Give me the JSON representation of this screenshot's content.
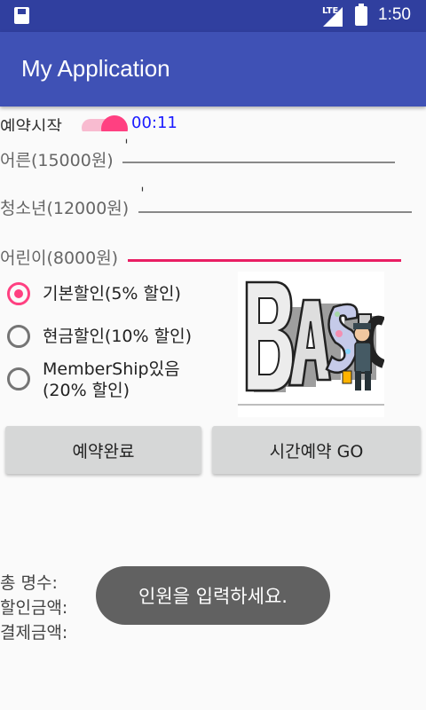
{
  "status_bar": {
    "network": "LTE",
    "time": "1:50",
    "icons": [
      "sd-card-icon",
      "signal-icon",
      "battery-icon"
    ]
  },
  "app_bar": {
    "title": "My Application"
  },
  "reservation": {
    "label": "예약시작",
    "switch_on": true,
    "time": "00:11"
  },
  "fields": {
    "adult": {
      "label": "어른(15000원)",
      "value": ""
    },
    "teen": {
      "label": "청소년(12000원)",
      "value": ""
    },
    "child": {
      "label": "어린이(8000원)",
      "value": ""
    }
  },
  "discounts": {
    "selected": "basic",
    "options": [
      {
        "id": "basic",
        "label": "기본할인(5% 할인)"
      },
      {
        "id": "cash",
        "label": "현금할인(10% 할인)"
      },
      {
        "id": "member",
        "label": "MemberShip있음\n(20% 할인)"
      }
    ]
  },
  "image": {
    "text": "BASIC"
  },
  "buttons": {
    "complete": "예약완료",
    "time_reserve": "시간예약 GO"
  },
  "summary": {
    "total_count": "총 명수:",
    "discount_amount": "할인금액:",
    "payment_amount": "결제금액:"
  },
  "toast": {
    "message": "인원을 입력하세요."
  },
  "colors": {
    "primary": "#3f51b5",
    "primary_dark": "#303f9f",
    "accent": "#ff4081"
  }
}
